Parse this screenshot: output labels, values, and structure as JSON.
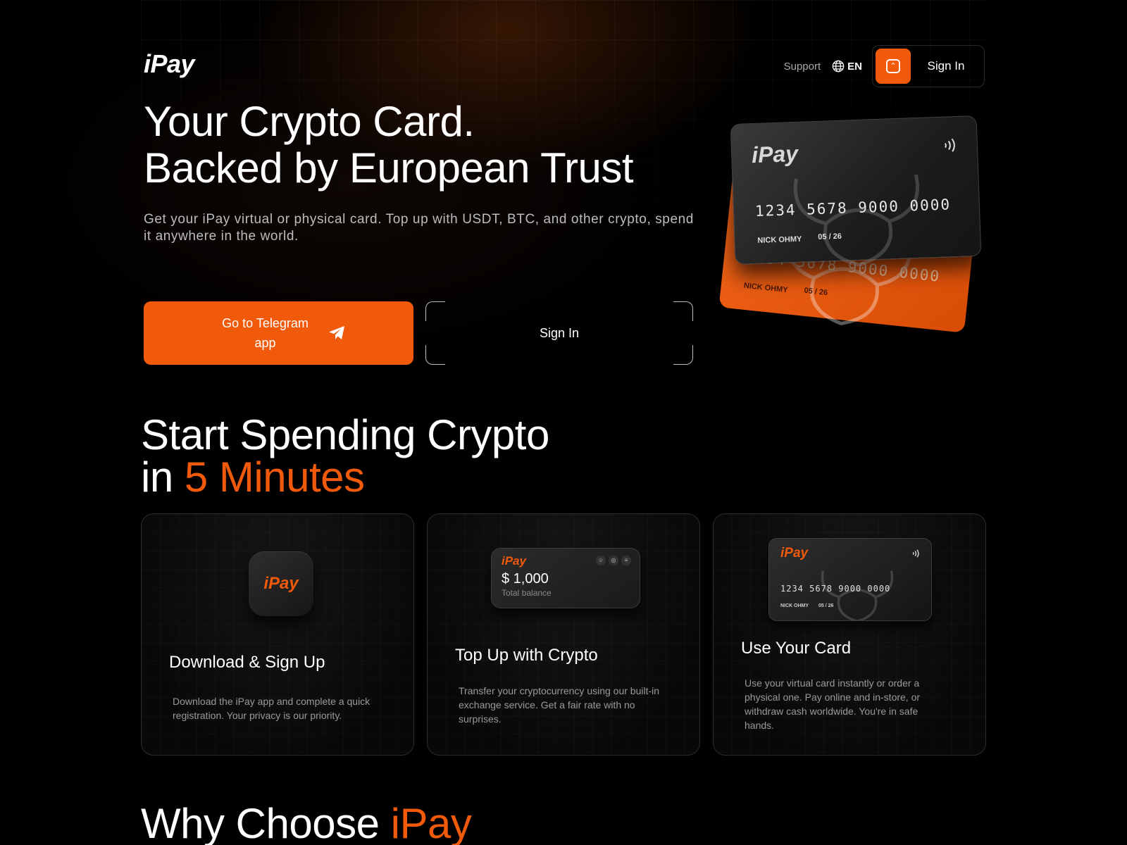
{
  "header": {
    "logo": "iPay",
    "support_label": "Support",
    "language": "EN",
    "signin_label": "Sign In"
  },
  "hero": {
    "title_line1": "Your Crypto Card.",
    "title_line2": "Backed by European Trust",
    "subtitle": "Get your iPay virtual or physical card. Top up with USDT, BTC, and other crypto, spend it anywhere in the world.",
    "primary_button": "Go to Telegram app",
    "secondary_button": "Sign In"
  },
  "cards": {
    "logo": "iPay",
    "number": "1234 5678 9000 0000",
    "holder": "NICK OHMY",
    "expiry": "05 / 26"
  },
  "steps_section": {
    "title_line1": "Start Spending Crypto",
    "title_prefix": "in ",
    "title_accent": "5 Minutes",
    "steps": [
      {
        "title": "Download & Sign Up",
        "description": "Download the iPay app and complete a quick registration. Your privacy is our priority.",
        "app_icon_label": "iPay"
      },
      {
        "title": "Top Up with Crypto",
        "description": "Transfer your cryptocurrency using our built-in exchange service. Get a fair rate with no surprises.",
        "widget_logo": "iPay",
        "widget_amount": "$ 1,000",
        "widget_label": "Total balance"
      },
      {
        "title": "Use Your Card",
        "description": "Use your virtual card instantly or order a physical one. Pay online and in-store, or withdraw cash worldwide. You're in safe hands.",
        "card_logo": "iPay",
        "card_number": "1234 5678 9000 0000",
        "card_holder": "NICK OHMY",
        "card_expiry": "05 / 26"
      }
    ]
  },
  "why_section": {
    "title_prefix": "Why Choose ",
    "title_accent": "iPay"
  },
  "colors": {
    "accent": "#f15a0a",
    "background": "#000000",
    "muted_text": "#9a9a9a"
  }
}
